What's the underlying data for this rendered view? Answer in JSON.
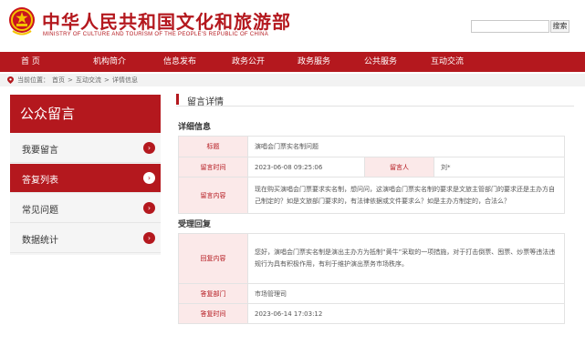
{
  "header": {
    "title_cn": "中华人民共和国文化和旅游部",
    "title_en": "MINISTRY OF CULTURE AND TOURISM OF THE PEOPLE'S REPUBLIC OF CHINA",
    "search_placeholder": "",
    "search_button": "搜索"
  },
  "nav": {
    "items": [
      {
        "label": "首  页"
      },
      {
        "label": "机构简介"
      },
      {
        "label": "信息发布"
      },
      {
        "label": "政务公开"
      },
      {
        "label": "政务服务"
      },
      {
        "label": "公共服务"
      },
      {
        "label": "互动交流"
      }
    ]
  },
  "breadcrumb": {
    "prefix": "当前位置：",
    "items": [
      "首页",
      "互动交流",
      "详情信息"
    ],
    "separator": ">"
  },
  "sidebar": {
    "title": "公众留言",
    "items": [
      {
        "label": "我要留言",
        "active": false
      },
      {
        "label": "答复列表",
        "active": true
      },
      {
        "label": "常见问题",
        "active": false
      },
      {
        "label": "数据统计",
        "active": false
      }
    ]
  },
  "main": {
    "title": "留言详情",
    "detail_heading": "详细信息",
    "detail": {
      "subject_label": "标题",
      "subject_value": "演唱会门票实名制问题",
      "time_label": "留言时间",
      "time_value": "2023-06-08 09:25:06",
      "author_label": "留言人",
      "author_value": "刘*",
      "content_label": "留言内容",
      "content_value": "现在购买演唱会门票要求实名制，想问问，这演唱会门票实名制的要求是文旅主管部门的要求还是主办方自己制定的？如是文旅部门要求的，有法律依据或文件要求么？如是主办方制定的，合法么？"
    },
    "reply_heading": "受理回复",
    "reply": {
      "content_label": "回复内容",
      "content_value": "您好，演唱会门票实名制是演出主办方为抵制“黄牛”采取的一项措施，对于打击倒票、囤票、炒票等违法违规行为具有积极作用，有利于维护演出票务市场秩序。",
      "dept_label": "答复部门",
      "dept_value": "市场管理司",
      "time_label": "答复时间",
      "time_value": "2023-06-14 17:03:12"
    }
  },
  "colors": {
    "brand_red": "#b4181e",
    "label_bg": "#fbe9e9"
  }
}
